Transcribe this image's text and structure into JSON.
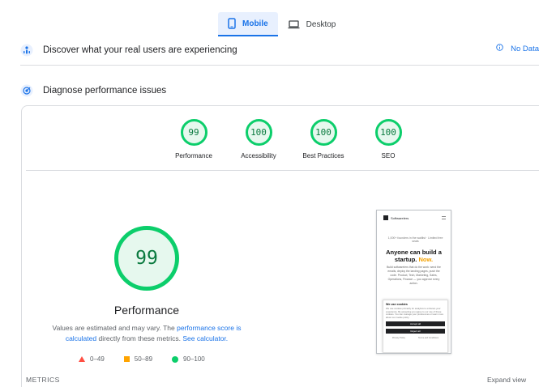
{
  "tabs": [
    {
      "label": "Mobile",
      "icon": "mobile-icon",
      "active": true
    },
    {
      "label": "Desktop",
      "icon": "desktop-icon",
      "active": false
    }
  ],
  "field_section": {
    "title": "Discover what your real users are experiencing",
    "no_data_label": "No Data",
    "icon": "field-data-icon",
    "no_data_icon": "info-icon"
  },
  "lab_section": {
    "title": "Diagnose performance issues",
    "icon": "lab-data-icon"
  },
  "categories": [
    {
      "score": "99",
      "label": "Performance"
    },
    {
      "score": "100",
      "label": "Accessibility"
    },
    {
      "score": "100",
      "label": "Best Practices"
    },
    {
      "score": "100",
      "label": "SEO"
    }
  ],
  "performance": {
    "score": "99",
    "title": "Performance",
    "desc_prefix": "Values are estimated and may vary. The ",
    "desc_link1": "performance score is calculated",
    "desc_middle": " directly from these metrics. ",
    "desc_link2": "See calculator."
  },
  "legend": [
    {
      "range": "0–49",
      "shape": "triangle",
      "color": "#ff4e42"
    },
    {
      "range": "50–89",
      "shape": "square",
      "color": "#ffa400"
    },
    {
      "range": "90–100",
      "shape": "circle",
      "color": "#0cce6b"
    }
  ],
  "metrics_label": "METRICS",
  "expand_label": "Expand view",
  "screenshot": {
    "brand": "Softwarelers",
    "badge": "1,000+ founders in the waitlist · Limited free seats",
    "headline": "Anyone can build a startup.",
    "headline_accent": "Now.",
    "body": "Build softwarelers that do the work: send the emails, deploy the landing pages, push the code. Product, Tech, Marketing, Sales, Operations, Finance — you approve every action.",
    "cookie_title": "We use cookies",
    "cookie_text": "We use cookies primarily for analytics to enhance your experience. By accepting you agree to our use of these cookies. You can manage your preferences or learn more about our cookie policy.",
    "accept_label": "Accept all",
    "reject_label": "Reject all",
    "privacy_label": "Privacy Policy",
    "terms_label": "Terms and Conditions"
  },
  "colors": {
    "accent": "#1a73e8",
    "pass": "#0cce6b",
    "pass_text": "#0a7a3f",
    "average": "#ffa400",
    "fail": "#ff4e42"
  }
}
